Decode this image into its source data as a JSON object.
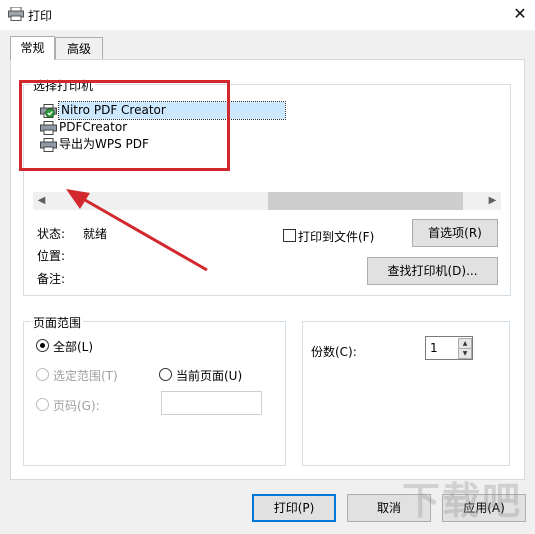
{
  "window": {
    "title": "打印",
    "close_icon": "close-icon"
  },
  "tabs": [
    {
      "label": "常规",
      "active": true
    },
    {
      "label": "高级",
      "active": false
    }
  ],
  "select_printer": {
    "legend": "选择打印机",
    "printers": [
      {
        "name": "Nitro PDF Creator",
        "selected": true,
        "icon": "printer-default-icon"
      },
      {
        "name": "PDFCreator",
        "selected": false,
        "icon": "printer-icon"
      },
      {
        "name": "导出为WPS PDF",
        "selected": false,
        "icon": "printer-icon"
      }
    ],
    "status_label": "状态:",
    "status_value": "就绪",
    "location_label": "位置:",
    "comment_label": "备注:",
    "print_to_file_label": "打印到文件(F)",
    "print_to_file_checked": false,
    "preferences_button": "首选项(R)",
    "find_printer_button": "查找打印机(D)..."
  },
  "page_range": {
    "legend": "页面范围",
    "all_label": "全部(L)",
    "selection_label": "选定范围(T)",
    "current_page_label": "当前页面(U)",
    "pages_label": "页码(G):",
    "pages_value": "",
    "selected": "all"
  },
  "copies": {
    "label": "份数(C):",
    "value": "1"
  },
  "footer": {
    "print_button": "打印(P)",
    "cancel_button": "取消",
    "apply_button": "应用(A)"
  },
  "annotation": {
    "frame_color": "#d2282d",
    "arrow_color": "#d2282d"
  },
  "watermark": "下载吧"
}
